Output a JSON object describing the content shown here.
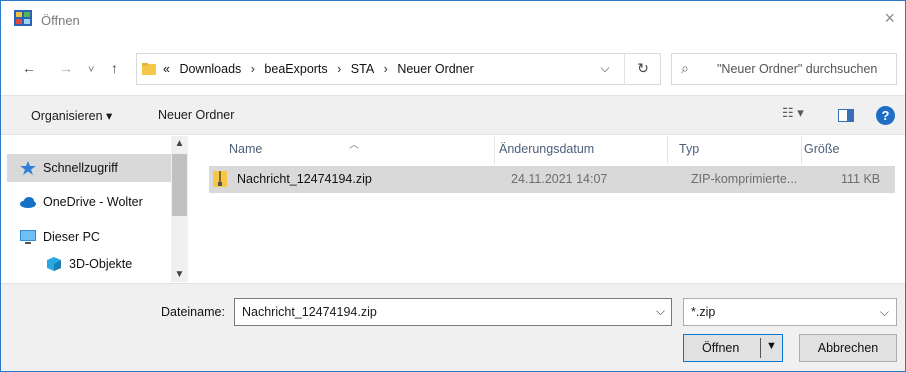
{
  "window": {
    "title": "Öffnen",
    "close_glyph": "×"
  },
  "nav": {
    "back_glyph": "←",
    "forward_glyph": "→",
    "recent_glyph": "˅",
    "up_glyph": "↑"
  },
  "address": {
    "overflow": "«",
    "crumbs": [
      "Downloads",
      "beaExports",
      "STA",
      "Neuer Ordner"
    ],
    "separator": "›",
    "dropdown_glyph": "⌵",
    "refresh_glyph": "↻"
  },
  "search": {
    "placeholder": "\"Neuer Ordner\" durchsuchen",
    "icon_glyph": "⌕"
  },
  "toolbar": {
    "organize_label": "Organisieren ▾",
    "new_folder_label": "Neuer Ordner",
    "view_glyph": "☷ ▾",
    "help_glyph": "?"
  },
  "sidebar": {
    "items": [
      {
        "label": "Schnellzugriff",
        "icon": "star-icon",
        "color": "#2f7fd8"
      },
      {
        "label": "OneDrive - Wolter",
        "icon": "cloud-icon",
        "color": "#1570c7"
      },
      {
        "label": "Dieser PC",
        "icon": "monitor-icon",
        "color": "#2f8fd6"
      },
      {
        "label": "3D-Objekte",
        "icon": "cube-icon",
        "color": "#29a8e0"
      }
    ],
    "scroll_up_glyph": "▲",
    "scroll_down_glyph": "▼"
  },
  "columns": {
    "name": "Name",
    "date": "Änderungsdatum",
    "type": "Typ",
    "size": "Größe",
    "sort_glyph": "︿"
  },
  "files": [
    {
      "name": "Nachricht_12474194.zip",
      "date": "24.11.2021 14:07",
      "type": "ZIP-komprimierte...",
      "size": "111 KB"
    }
  ],
  "footer": {
    "filename_label": "Dateiname:",
    "filename_value": "Nachricht_12474194.zip",
    "filename_dd_glyph": "⌵",
    "filetype_value": "*.zip",
    "filetype_dd_glyph": "⌵",
    "open_label": "Öffnen",
    "open_arrow": "▼",
    "cancel_label": "Abbrechen"
  },
  "colors": {
    "accent": "#0078d7",
    "selection": "#d9d9d9",
    "toolbar_bg": "#f0f0f0"
  }
}
